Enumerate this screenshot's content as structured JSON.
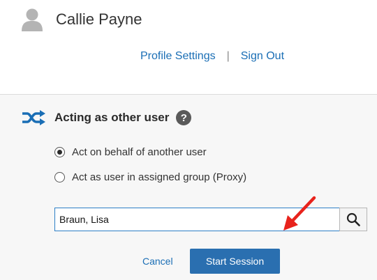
{
  "user": {
    "name": "Callie Payne",
    "avatar_icon": "person-icon"
  },
  "links": {
    "profile_settings": "Profile Settings",
    "separator": "|",
    "sign_out": "Sign Out"
  },
  "panel": {
    "title": "Acting as other user",
    "title_icon": "shuffle-icon",
    "help_icon": "help-icon",
    "help_glyph": "?",
    "options": [
      {
        "label": "Act on behalf of another user",
        "selected": true
      },
      {
        "label": "Act as user in assigned group (Proxy)",
        "selected": false
      }
    ],
    "search": {
      "value": "Braun, Lisa",
      "icon": "search-icon"
    },
    "annotation_icon": "red-arrow-icon",
    "cancel_label": "Cancel",
    "start_label": "Start Session"
  },
  "colors": {
    "link": "#1a6eb5",
    "primary_button": "#2a6fb0",
    "panel_background": "#f7f7f7",
    "annotation_arrow": "#e8231c",
    "shuffle_icon": "#1a6eb5"
  }
}
